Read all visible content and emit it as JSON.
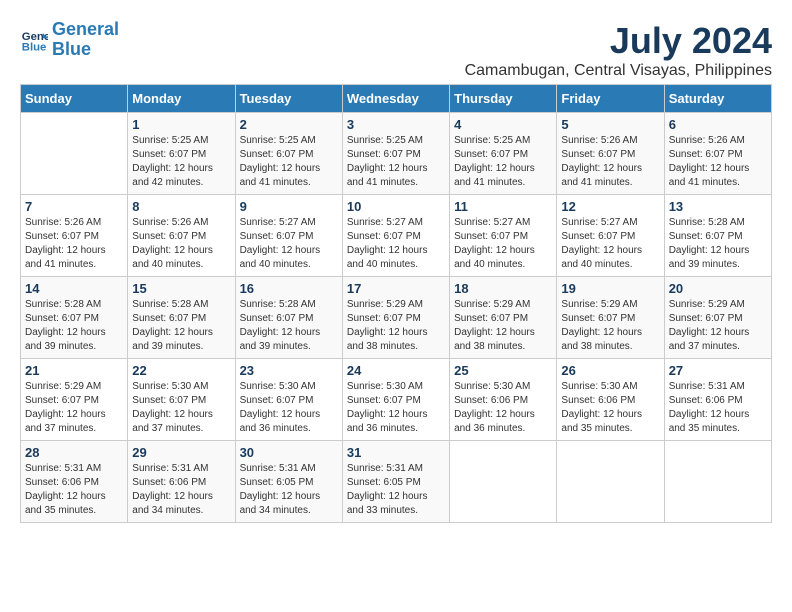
{
  "logo": {
    "line1": "General",
    "line2": "Blue"
  },
  "title": "July 2024",
  "subtitle": "Camambugan, Central Visayas, Philippines",
  "weekdays": [
    "Sunday",
    "Monday",
    "Tuesday",
    "Wednesday",
    "Thursday",
    "Friday",
    "Saturday"
  ],
  "weeks": [
    [
      {
        "day": "",
        "info": ""
      },
      {
        "day": "1",
        "info": "Sunrise: 5:25 AM\nSunset: 6:07 PM\nDaylight: 12 hours\nand 42 minutes."
      },
      {
        "day": "2",
        "info": "Sunrise: 5:25 AM\nSunset: 6:07 PM\nDaylight: 12 hours\nand 41 minutes."
      },
      {
        "day": "3",
        "info": "Sunrise: 5:25 AM\nSunset: 6:07 PM\nDaylight: 12 hours\nand 41 minutes."
      },
      {
        "day": "4",
        "info": "Sunrise: 5:25 AM\nSunset: 6:07 PM\nDaylight: 12 hours\nand 41 minutes."
      },
      {
        "day": "5",
        "info": "Sunrise: 5:26 AM\nSunset: 6:07 PM\nDaylight: 12 hours\nand 41 minutes."
      },
      {
        "day": "6",
        "info": "Sunrise: 5:26 AM\nSunset: 6:07 PM\nDaylight: 12 hours\nand 41 minutes."
      }
    ],
    [
      {
        "day": "7",
        "info": "Sunrise: 5:26 AM\nSunset: 6:07 PM\nDaylight: 12 hours\nand 41 minutes."
      },
      {
        "day": "8",
        "info": "Sunrise: 5:26 AM\nSunset: 6:07 PM\nDaylight: 12 hours\nand 40 minutes."
      },
      {
        "day": "9",
        "info": "Sunrise: 5:27 AM\nSunset: 6:07 PM\nDaylight: 12 hours\nand 40 minutes."
      },
      {
        "day": "10",
        "info": "Sunrise: 5:27 AM\nSunset: 6:07 PM\nDaylight: 12 hours\nand 40 minutes."
      },
      {
        "day": "11",
        "info": "Sunrise: 5:27 AM\nSunset: 6:07 PM\nDaylight: 12 hours\nand 40 minutes."
      },
      {
        "day": "12",
        "info": "Sunrise: 5:27 AM\nSunset: 6:07 PM\nDaylight: 12 hours\nand 40 minutes."
      },
      {
        "day": "13",
        "info": "Sunrise: 5:28 AM\nSunset: 6:07 PM\nDaylight: 12 hours\nand 39 minutes."
      }
    ],
    [
      {
        "day": "14",
        "info": "Sunrise: 5:28 AM\nSunset: 6:07 PM\nDaylight: 12 hours\nand 39 minutes."
      },
      {
        "day": "15",
        "info": "Sunrise: 5:28 AM\nSunset: 6:07 PM\nDaylight: 12 hours\nand 39 minutes."
      },
      {
        "day": "16",
        "info": "Sunrise: 5:28 AM\nSunset: 6:07 PM\nDaylight: 12 hours\nand 39 minutes."
      },
      {
        "day": "17",
        "info": "Sunrise: 5:29 AM\nSunset: 6:07 PM\nDaylight: 12 hours\nand 38 minutes."
      },
      {
        "day": "18",
        "info": "Sunrise: 5:29 AM\nSunset: 6:07 PM\nDaylight: 12 hours\nand 38 minutes."
      },
      {
        "day": "19",
        "info": "Sunrise: 5:29 AM\nSunset: 6:07 PM\nDaylight: 12 hours\nand 38 minutes."
      },
      {
        "day": "20",
        "info": "Sunrise: 5:29 AM\nSunset: 6:07 PM\nDaylight: 12 hours\nand 37 minutes."
      }
    ],
    [
      {
        "day": "21",
        "info": "Sunrise: 5:29 AM\nSunset: 6:07 PM\nDaylight: 12 hours\nand 37 minutes."
      },
      {
        "day": "22",
        "info": "Sunrise: 5:30 AM\nSunset: 6:07 PM\nDaylight: 12 hours\nand 37 minutes."
      },
      {
        "day": "23",
        "info": "Sunrise: 5:30 AM\nSunset: 6:07 PM\nDaylight: 12 hours\nand 36 minutes."
      },
      {
        "day": "24",
        "info": "Sunrise: 5:30 AM\nSunset: 6:07 PM\nDaylight: 12 hours\nand 36 minutes."
      },
      {
        "day": "25",
        "info": "Sunrise: 5:30 AM\nSunset: 6:06 PM\nDaylight: 12 hours\nand 36 minutes."
      },
      {
        "day": "26",
        "info": "Sunrise: 5:30 AM\nSunset: 6:06 PM\nDaylight: 12 hours\nand 35 minutes."
      },
      {
        "day": "27",
        "info": "Sunrise: 5:31 AM\nSunset: 6:06 PM\nDaylight: 12 hours\nand 35 minutes."
      }
    ],
    [
      {
        "day": "28",
        "info": "Sunrise: 5:31 AM\nSunset: 6:06 PM\nDaylight: 12 hours\nand 35 minutes."
      },
      {
        "day": "29",
        "info": "Sunrise: 5:31 AM\nSunset: 6:06 PM\nDaylight: 12 hours\nand 34 minutes."
      },
      {
        "day": "30",
        "info": "Sunrise: 5:31 AM\nSunset: 6:05 PM\nDaylight: 12 hours\nand 34 minutes."
      },
      {
        "day": "31",
        "info": "Sunrise: 5:31 AM\nSunset: 6:05 PM\nDaylight: 12 hours\nand 33 minutes."
      },
      {
        "day": "",
        "info": ""
      },
      {
        "day": "",
        "info": ""
      },
      {
        "day": "",
        "info": ""
      }
    ]
  ]
}
